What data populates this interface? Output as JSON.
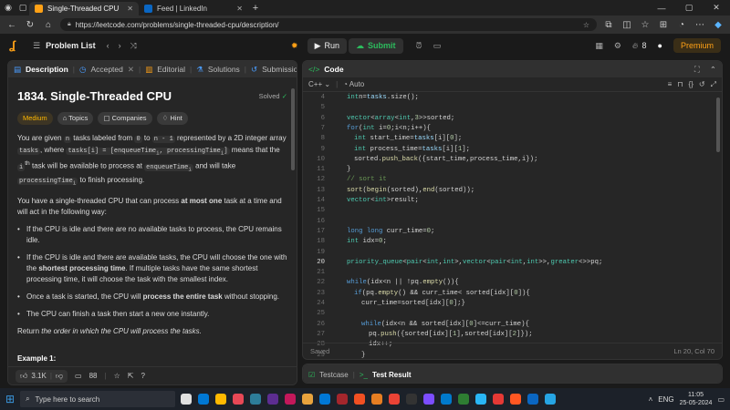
{
  "browser": {
    "tabs": [
      {
        "title": "Single-Threaded CPU - LeetCode",
        "active": true,
        "fav_color": "#ffa116"
      },
      {
        "title": "Feed | LinkedIn",
        "active": false,
        "fav_color": "#0a66c2"
      }
    ],
    "new_tab": "+",
    "url": "https://leetcode.com/problems/single-threaded-cpu/description/"
  },
  "topbar": {
    "problem_list": "Problem List",
    "run": "Run",
    "submit": "Submit",
    "streak": "8",
    "premium": "Premium"
  },
  "left": {
    "tabs": [
      "Description",
      "Accepted",
      "Editorial",
      "Solutions",
      "Submissions"
    ],
    "title": "1834. Single-Threaded CPU",
    "solved": "Solved",
    "chips": [
      "Medium",
      "Topics",
      "Companies",
      "Hint"
    ],
    "para1": {
      "a": "You are given ",
      "n": "n",
      "b": " tasks labeled from ",
      "zero": "0",
      "c": " to ",
      "nm1": "n - 1",
      "d": " represented by a 2D integer array ",
      "tasks": "tasks",
      "e": ", where ",
      "tasksi": "tasks[i] = [enqueueTime",
      "sub1": "i",
      "proc": ", processingTime",
      "sub2": "i",
      "close": "]",
      "f": " means that the ",
      "ith": "i",
      "th": "th",
      "g": " task will be available to process at ",
      "enq": "enqueueTime",
      "sub3": "i",
      "h": " and will take ",
      "pt": "processingTime",
      "sub4": "i",
      "k": " to finish processing."
    },
    "para2": {
      "a": "You have a single-threaded CPU that can process ",
      "b": "at most one",
      "c": " task at a time and will act in the following way:"
    },
    "bullets": [
      {
        "a": "If the CPU is idle and there are no available tasks to process, the CPU remains idle.",
        "b": "",
        "c": ""
      },
      {
        "a": "If the CPU is idle and there are available tasks, the CPU will choose the one with the ",
        "b": "shortest processing time",
        "c": ". If multiple tasks have the same shortest processing time, it will choose the task with the smallest index."
      },
      {
        "a": "Once a task is started, the CPU will ",
        "b": "process the entire task",
        "c": " without stopping."
      },
      {
        "a": "The CPU can finish a task then start a new one instantly.",
        "b": "",
        "c": ""
      }
    ],
    "para3": {
      "a": "Return ",
      "b": "the order in which the CPU will process the tasks.",
      "c": ""
    },
    "example_heading": "Example 1:",
    "likes": "3.1K",
    "comments": "88"
  },
  "right": {
    "header": "Code",
    "language": "C++",
    "mode": "Auto",
    "status_left": "Saved",
    "status_right": "Ln 20, Col 70",
    "bottom_tabs": [
      "Testcase",
      "Test Result"
    ]
  },
  "code_lines": [
    {
      "n": "4",
      "i": 1,
      "t": [
        [
          "ty",
          "int"
        ],
        [
          "",
          "n="
        ],
        [
          "var",
          "tasks"
        ],
        [
          "",
          ".size();"
        ]
      ]
    },
    {
      "n": "5",
      "i": 0,
      "t": []
    },
    {
      "n": "6",
      "i": 1,
      "t": [
        [
          "ty",
          "vector"
        ],
        [
          "",
          "<"
        ],
        [
          "ty",
          "array"
        ],
        [
          "",
          "<"
        ],
        [
          "ty",
          "int"
        ],
        [
          "",
          ","
        ],
        [
          "num",
          "3"
        ],
        [
          "",
          ">>"
        ],
        [
          "",
          "sorted;"
        ]
      ]
    },
    {
      "n": "7",
      "i": 1,
      "t": [
        [
          "kw",
          "for"
        ],
        [
          "",
          "("
        ],
        [
          "ty",
          "int"
        ],
        [
          "",
          " i="
        ],
        [
          "num",
          "0"
        ],
        [
          "",
          ";i<n;i++){"
        ]
      ]
    },
    {
      "n": "8",
      "i": 2,
      "t": [
        [
          "ty",
          "int"
        ],
        [
          "",
          " start_time="
        ],
        [
          "var",
          "tasks"
        ],
        [
          "",
          "[i]["
        ],
        [
          "num",
          "0"
        ],
        [
          "",
          "];"
        ]
      ]
    },
    {
      "n": "9",
      "i": 2,
      "t": [
        [
          "ty",
          "int"
        ],
        [
          "",
          " process_time="
        ],
        [
          "var",
          "tasks"
        ],
        [
          "",
          "[i]["
        ],
        [
          "num",
          "1"
        ],
        [
          "",
          "];"
        ]
      ]
    },
    {
      "n": "10",
      "i": 2,
      "t": [
        [
          "",
          "sorted."
        ],
        [
          "fn",
          "push_back"
        ],
        [
          "",
          "({start_time,process_time,i});"
        ]
      ]
    },
    {
      "n": "11",
      "i": 1,
      "t": [
        [
          "",
          "}"
        ]
      ]
    },
    {
      "n": "12",
      "i": 1,
      "t": [
        [
          "cm",
          "// sort it"
        ]
      ]
    },
    {
      "n": "13",
      "i": 1,
      "t": [
        [
          "fn",
          "sort"
        ],
        [
          "",
          "("
        ],
        [
          "fn",
          "begin"
        ],
        [
          "",
          "(sorted),"
        ],
        [
          "fn",
          "end"
        ],
        [
          "",
          "(sorted));"
        ]
      ]
    },
    {
      "n": "14",
      "i": 1,
      "t": [
        [
          "ty",
          "vector"
        ],
        [
          "",
          "<"
        ],
        [
          "ty",
          "int"
        ],
        [
          "",
          ">result;"
        ]
      ]
    },
    {
      "n": "15",
      "i": 0,
      "t": []
    },
    {
      "n": "16",
      "i": 0,
      "t": []
    },
    {
      "n": "17",
      "i": 1,
      "t": [
        [
          "kw",
          "long long"
        ],
        [
          "",
          " curr_time="
        ],
        [
          "num",
          "0"
        ],
        [
          "",
          ";"
        ]
      ]
    },
    {
      "n": "18",
      "i": 1,
      "t": [
        [
          "ty",
          "int"
        ],
        [
          "",
          " idx="
        ],
        [
          "num",
          "0"
        ],
        [
          "",
          ";"
        ]
      ]
    },
    {
      "n": "19",
      "i": 0,
      "t": []
    },
    {
      "n": "20",
      "i": 1,
      "t": [
        [
          "ty",
          "priority_queue"
        ],
        [
          "",
          "<"
        ],
        [
          "ty",
          "pair"
        ],
        [
          "",
          "<"
        ],
        [
          "ty",
          "int"
        ],
        [
          "",
          ","
        ],
        [
          "ty",
          "int"
        ],
        [
          "",
          ">,"
        ],
        [
          "ty",
          "vector"
        ],
        [
          "",
          "<"
        ],
        [
          "ty",
          "pair"
        ],
        [
          "",
          "<"
        ],
        [
          "ty",
          "int"
        ],
        [
          "",
          ","
        ],
        [
          "ty",
          "int"
        ],
        [
          "",
          ">>,"
        ],
        [
          "ty",
          "greater"
        ],
        [
          "",
          "<>>pq;"
        ]
      ]
    },
    {
      "n": "21",
      "i": 0,
      "t": []
    },
    {
      "n": "22",
      "i": 1,
      "t": [
        [
          "kw",
          "while"
        ],
        [
          "",
          "(idx<n || !pq."
        ],
        [
          "fn",
          "empty"
        ],
        [
          "",
          "()){"
        ]
      ]
    },
    {
      "n": "23",
      "i": 2,
      "t": [
        [
          "kw",
          "if"
        ],
        [
          "",
          "(pq."
        ],
        [
          "fn",
          "empty"
        ],
        [
          "",
          "() && curr_time< sorted[idx]["
        ],
        [
          "num",
          "0"
        ],
        [
          "",
          "]){"
        ]
      ]
    },
    {
      "n": "24",
      "i": 3,
      "t": [
        [
          "",
          "curr_time=sorted[idx]["
        ],
        [
          "num",
          "0"
        ],
        [
          "",
          "];}"
        ]
      ]
    },
    {
      "n": "25",
      "i": 0,
      "t": []
    },
    {
      "n": "26",
      "i": 3,
      "t": [
        [
          "kw",
          "while"
        ],
        [
          "",
          "(idx<n && sorted[idx]["
        ],
        [
          "num",
          "0"
        ],
        [
          "",
          "]<=curr_time){"
        ]
      ]
    },
    {
      "n": "27",
      "i": 4,
      "t": [
        [
          "",
          "pq."
        ],
        [
          "fn",
          "push"
        ],
        [
          "",
          "({sorted[idx]["
        ],
        [
          "num",
          "1"
        ],
        [
          "",
          "],sorted[idx]["
        ],
        [
          "num",
          "2"
        ],
        [
          "",
          "]});"
        ]
      ]
    },
    {
      "n": "28",
      "i": 4,
      "t": [
        [
          "",
          "idx++;"
        ]
      ]
    },
    {
      "n": "29",
      "i": 3,
      "t": [
        [
          "",
          "}"
        ]
      ]
    }
  ],
  "taskbar": {
    "search_placeholder": "Type here to search",
    "lang": "ENG",
    "time": "11:05",
    "date": "25-05-2024",
    "apps": [
      "#e0e0e0",
      "#0078d4",
      "#ffb900",
      "#e74856",
      "#2d7d9a",
      "#5c2d91",
      "#c2185b",
      "#e8a33d",
      "#0078d7",
      "#a4262c",
      "#f25022",
      "#e67e22",
      "#ea4335",
      "#333333",
      "#7c4dff",
      "#007acc",
      "#2e7d32",
      "#29b6f6",
      "#e53935",
      "#ff5722",
      "#0a66c2",
      "#26a5e4"
    ]
  }
}
